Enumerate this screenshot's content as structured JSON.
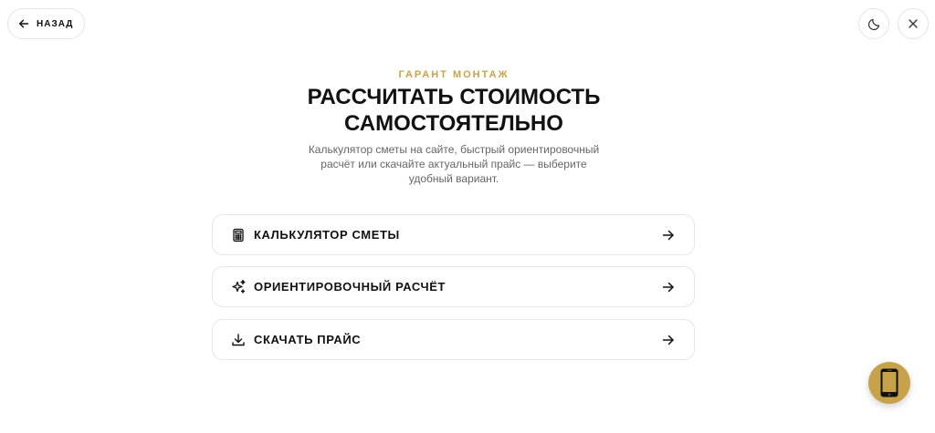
{
  "nav": {
    "back_label": "НАЗАД"
  },
  "header": {
    "eyebrow": "ГАРАНТ МОНТАЖ",
    "title_line1": "РАССЧИТАТЬ СТОИМОСТЬ",
    "title_line2": "САМОСТОЯТЕЛЬНО",
    "subtitle_line1": "Калькулятор сметы на сайте, быстрый ориентировочный",
    "subtitle_line2": "расчёт или скачайте актуальный прайс — выберите",
    "subtitle_line3": "удобный вариант."
  },
  "options": [
    {
      "label": "КАЛЬКУЛЯТОР СМЕТЫ",
      "icon": "calculator-icon"
    },
    {
      "label": "ОРИЕНТИРОВОЧНЫЙ РАСЧЁТ",
      "icon": "sparkles-icon"
    },
    {
      "label": "СКАЧАТЬ ПРАЙС",
      "icon": "download-icon"
    }
  ],
  "colors": {
    "accent": "#c8a24a",
    "text": "#111111",
    "muted": "#666666",
    "border": "#e6e6e6"
  }
}
